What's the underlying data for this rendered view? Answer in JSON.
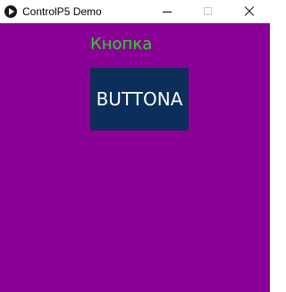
{
  "window": {
    "title": "ControlP5 Demo",
    "icon": "processing-play-icon"
  },
  "controls": {
    "minimize": "minimize-icon",
    "maximize": "maximize-icon",
    "close": "close-icon"
  },
  "canvas": {
    "background_color": "#8b0096",
    "label_text": "Кнопка",
    "label_color": "#2bd62b",
    "button_label": "BUTTONA",
    "button_color": "#0b2e5a"
  }
}
